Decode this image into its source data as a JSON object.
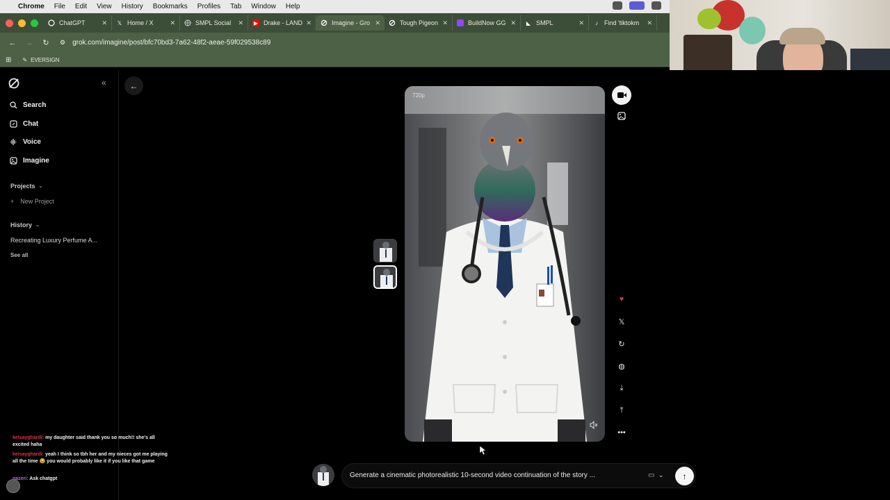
{
  "menubar": {
    "app": "Chrome",
    "items": [
      "File",
      "Edit",
      "View",
      "History",
      "Bookmarks",
      "Profiles",
      "Tab",
      "Window",
      "Help"
    ]
  },
  "tabs": [
    {
      "title": "ChatGPT",
      "favicon": "chatgpt-icon",
      "color": "#ffffff"
    },
    {
      "title": "Home / X",
      "favicon": "x-icon",
      "color": "#ffffff"
    },
    {
      "title": "SMPL Social",
      "favicon": "globe-icon",
      "color": "#ffffff"
    },
    {
      "title": "Drake - LAND",
      "favicon": "youtube-icon",
      "color": "#ff0000"
    },
    {
      "title": "Imagine - Gro",
      "favicon": "grok-icon",
      "color": "#ffffff",
      "active": true
    },
    {
      "title": "Tough Pigeon",
      "favicon": "grok-icon",
      "color": "#ffffff"
    },
    {
      "title": "BuildNow GG",
      "favicon": "twitch-icon",
      "color": "#9146ff"
    },
    {
      "title": "SMPL",
      "favicon": "smpl-icon",
      "color": "#ffffff"
    },
    {
      "title": "Find 'tiktokm",
      "favicon": "tiktok-icon",
      "color": "#ffffff"
    }
  ],
  "address": {
    "url": "grok.com/imagine/post/bfc70bd3-7a62-48f2-aeae-59f029538c89"
  },
  "bookmarks": {
    "items": [
      "EVERSIGN"
    ]
  },
  "sidebar": {
    "nav": [
      {
        "label": "Search",
        "icon": "search-icon"
      },
      {
        "label": "Chat",
        "icon": "chat-icon"
      },
      {
        "label": "Voice",
        "icon": "voice-icon"
      },
      {
        "label": "Imagine",
        "icon": "imagine-icon"
      }
    ],
    "projects_label": "Projects",
    "new_project": "New Project",
    "history_label": "History",
    "history_items": [
      "Recreating Luxury Perfume A..."
    ],
    "see_all": "See all"
  },
  "chat_overlay": [
    {
      "user": "kelsayghardi:",
      "text": "my daughter said thank you so much!! she's all excited haha"
    },
    {
      "user": "kelsayghardi:",
      "text": "yeah I think so tbh her and my nieces got me playing all the time 😂 you would probably like it if you like that game"
    },
    {
      "user": "gazeri:",
      "text": "Ask chatgpt"
    }
  ],
  "viewer": {
    "quality": "720p"
  },
  "prompt": {
    "text": "Generate a cinematic photorealistic 10-second video continuation of the story ..."
  },
  "colors": {
    "tabbar": "#3d4e38",
    "toolbar": "#4d6147",
    "heart": "#c63a4a"
  }
}
